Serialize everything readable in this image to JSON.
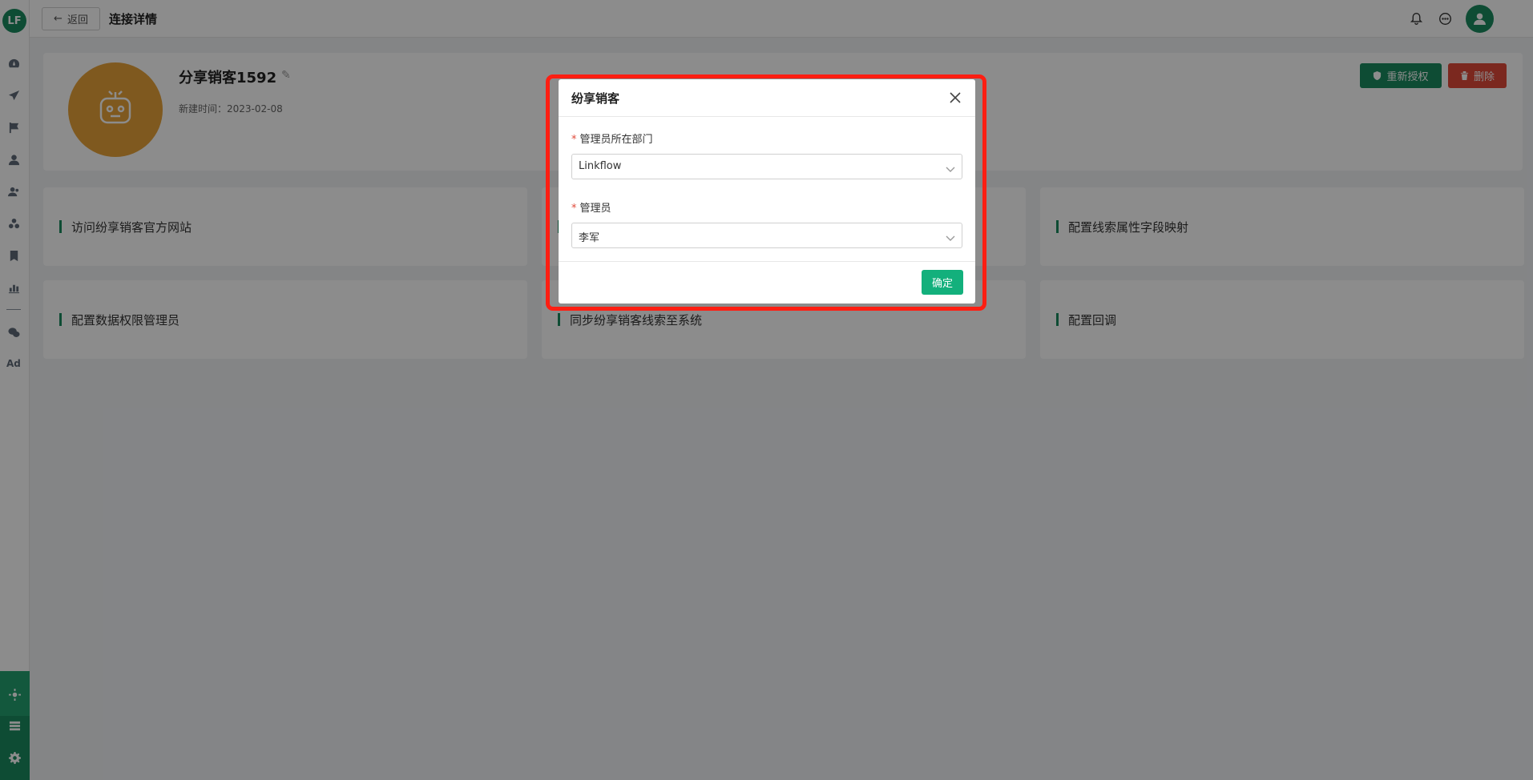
{
  "sidebar": {
    "logo_text": "LF",
    "icons": [
      "dashboard-icon",
      "send-icon",
      "flag-icon",
      "user-icon",
      "users-icon",
      "segments-icon",
      "bookmark-icon",
      "bar-chart-icon",
      "wechat-icon"
    ],
    "ad_label": "Ad",
    "bottom_icons": [
      "integration-icon",
      "server-icon",
      "settings-icon"
    ]
  },
  "header": {
    "back_label": "返回",
    "title": "连接详情"
  },
  "app": {
    "name": "分享销客1592",
    "created_label": "新建时间：",
    "created_date": "2023-02-08",
    "reauth_label": "重新授权",
    "delete_label": "删除"
  },
  "actions": [
    {
      "label": "访问纷享销客官方网站"
    },
    {
      "label": ""
    },
    {
      "label": "配置线索属性字段映射"
    },
    {
      "label": "配置数据权限管理员"
    },
    {
      "label": "同步纷享销客线索至系统"
    },
    {
      "label": "配置回调"
    }
  ],
  "modal": {
    "title": "纷享销客",
    "dept_label": "管理员所在部门",
    "dept_value": "Linkflow",
    "admin_label": "管理员",
    "admin_value": "李军",
    "required_mark": "*",
    "confirm_label": "确定"
  },
  "colors": {
    "brand": "#1a8a5f",
    "confirm": "#13b07c",
    "danger": "#e04a3a",
    "highlight": "#ff1e12"
  }
}
